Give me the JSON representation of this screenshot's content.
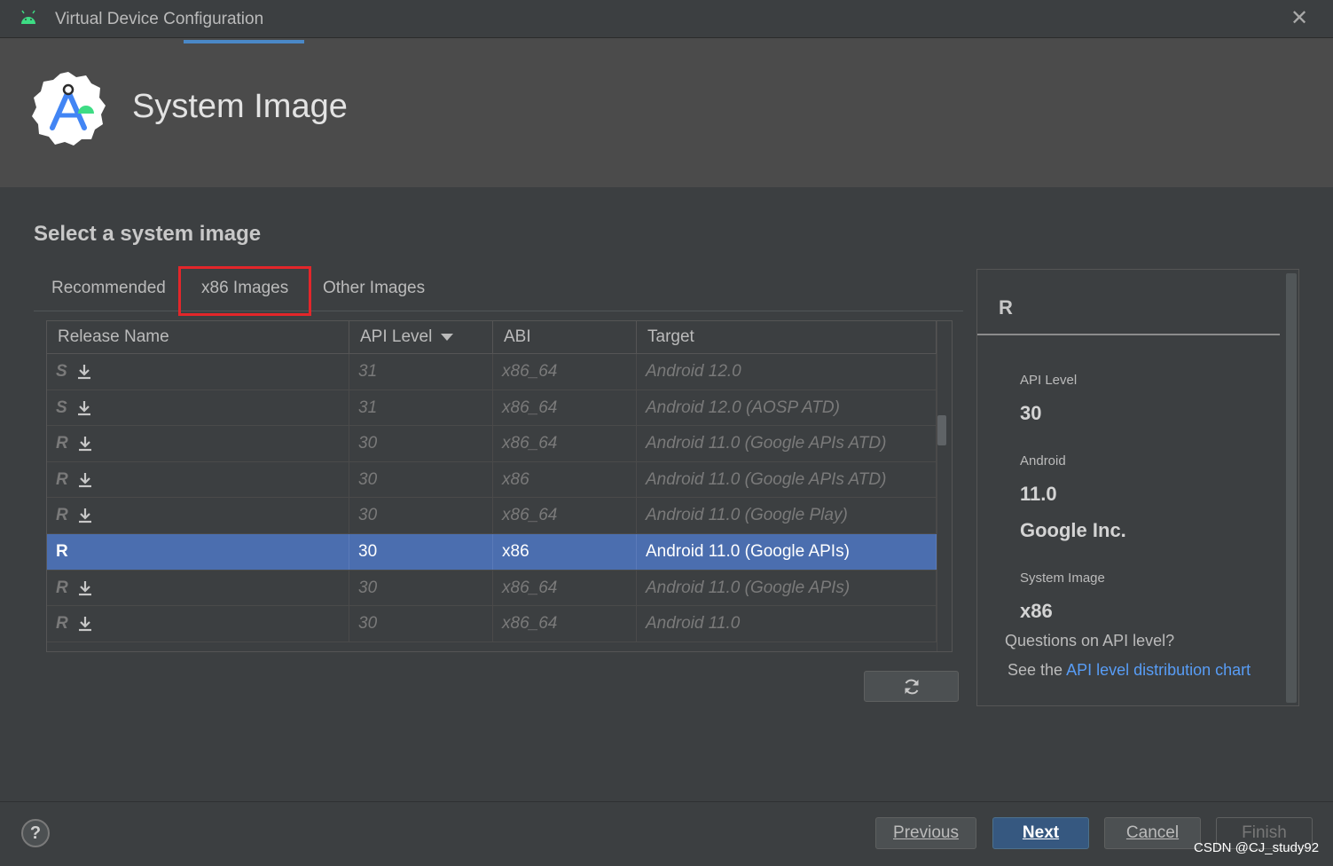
{
  "window": {
    "title": "Virtual Device Configuration"
  },
  "header": {
    "title": "System Image"
  },
  "main": {
    "section_title": "Select a system image",
    "tabs": [
      {
        "label": "Recommended",
        "active": false
      },
      {
        "label": "x86 Images",
        "active": true
      },
      {
        "label": "Other Images",
        "active": false
      }
    ],
    "table": {
      "columns": [
        "Release Name",
        "API Level",
        "ABI",
        "Target"
      ],
      "sort_column": "API Level",
      "rows": [
        {
          "release": "S",
          "api": "31",
          "abi": "x86_64",
          "target": "Android 12.0",
          "download": true,
          "selected": false
        },
        {
          "release": "S",
          "api": "31",
          "abi": "x86_64",
          "target": "Android 12.0 (AOSP ATD)",
          "download": true,
          "selected": false
        },
        {
          "release": "R",
          "api": "30",
          "abi": "x86_64",
          "target": "Android 11.0 (Google APIs ATD)",
          "download": true,
          "selected": false
        },
        {
          "release": "R",
          "api": "30",
          "abi": "x86",
          "target": "Android 11.0 (Google APIs ATD)",
          "download": true,
          "selected": false
        },
        {
          "release": "R",
          "api": "30",
          "abi": "x86_64",
          "target": "Android 11.0 (Google Play)",
          "download": true,
          "selected": false
        },
        {
          "release": "R",
          "api": "30",
          "abi": "x86",
          "target": "Android 11.0 (Google APIs)",
          "download": false,
          "selected": true
        },
        {
          "release": "R",
          "api": "30",
          "abi": "x86_64",
          "target": "Android 11.0 (Google APIs)",
          "download": true,
          "selected": false
        },
        {
          "release": "R",
          "api": "30",
          "abi": "x86_64",
          "target": "Android 11.0",
          "download": true,
          "selected": false
        }
      ]
    },
    "refresh_icon": "refresh-icon"
  },
  "details": {
    "title": "R",
    "api_level_label": "API Level",
    "api_level_value": "30",
    "android_label": "Android",
    "android_value": "11.0",
    "vendor": "Google Inc.",
    "system_image_label": "System Image",
    "system_image_value": "x86",
    "question": "Questions on API level?",
    "see_the": "See the ",
    "link_text": "API level distribution chart"
  },
  "footer": {
    "help_label": "?",
    "previous_label": "Previous",
    "next_label": "Next",
    "cancel_label": "Cancel",
    "finish_label": "Finish"
  },
  "watermark": "CSDN @CJ_study92",
  "colors": {
    "background": "#3c3f41",
    "header_bg": "#4b4b4b",
    "selection": "#4b6eaf",
    "link": "#589df6",
    "highlight_box": "#e3262a",
    "primary_button": "#365880"
  }
}
